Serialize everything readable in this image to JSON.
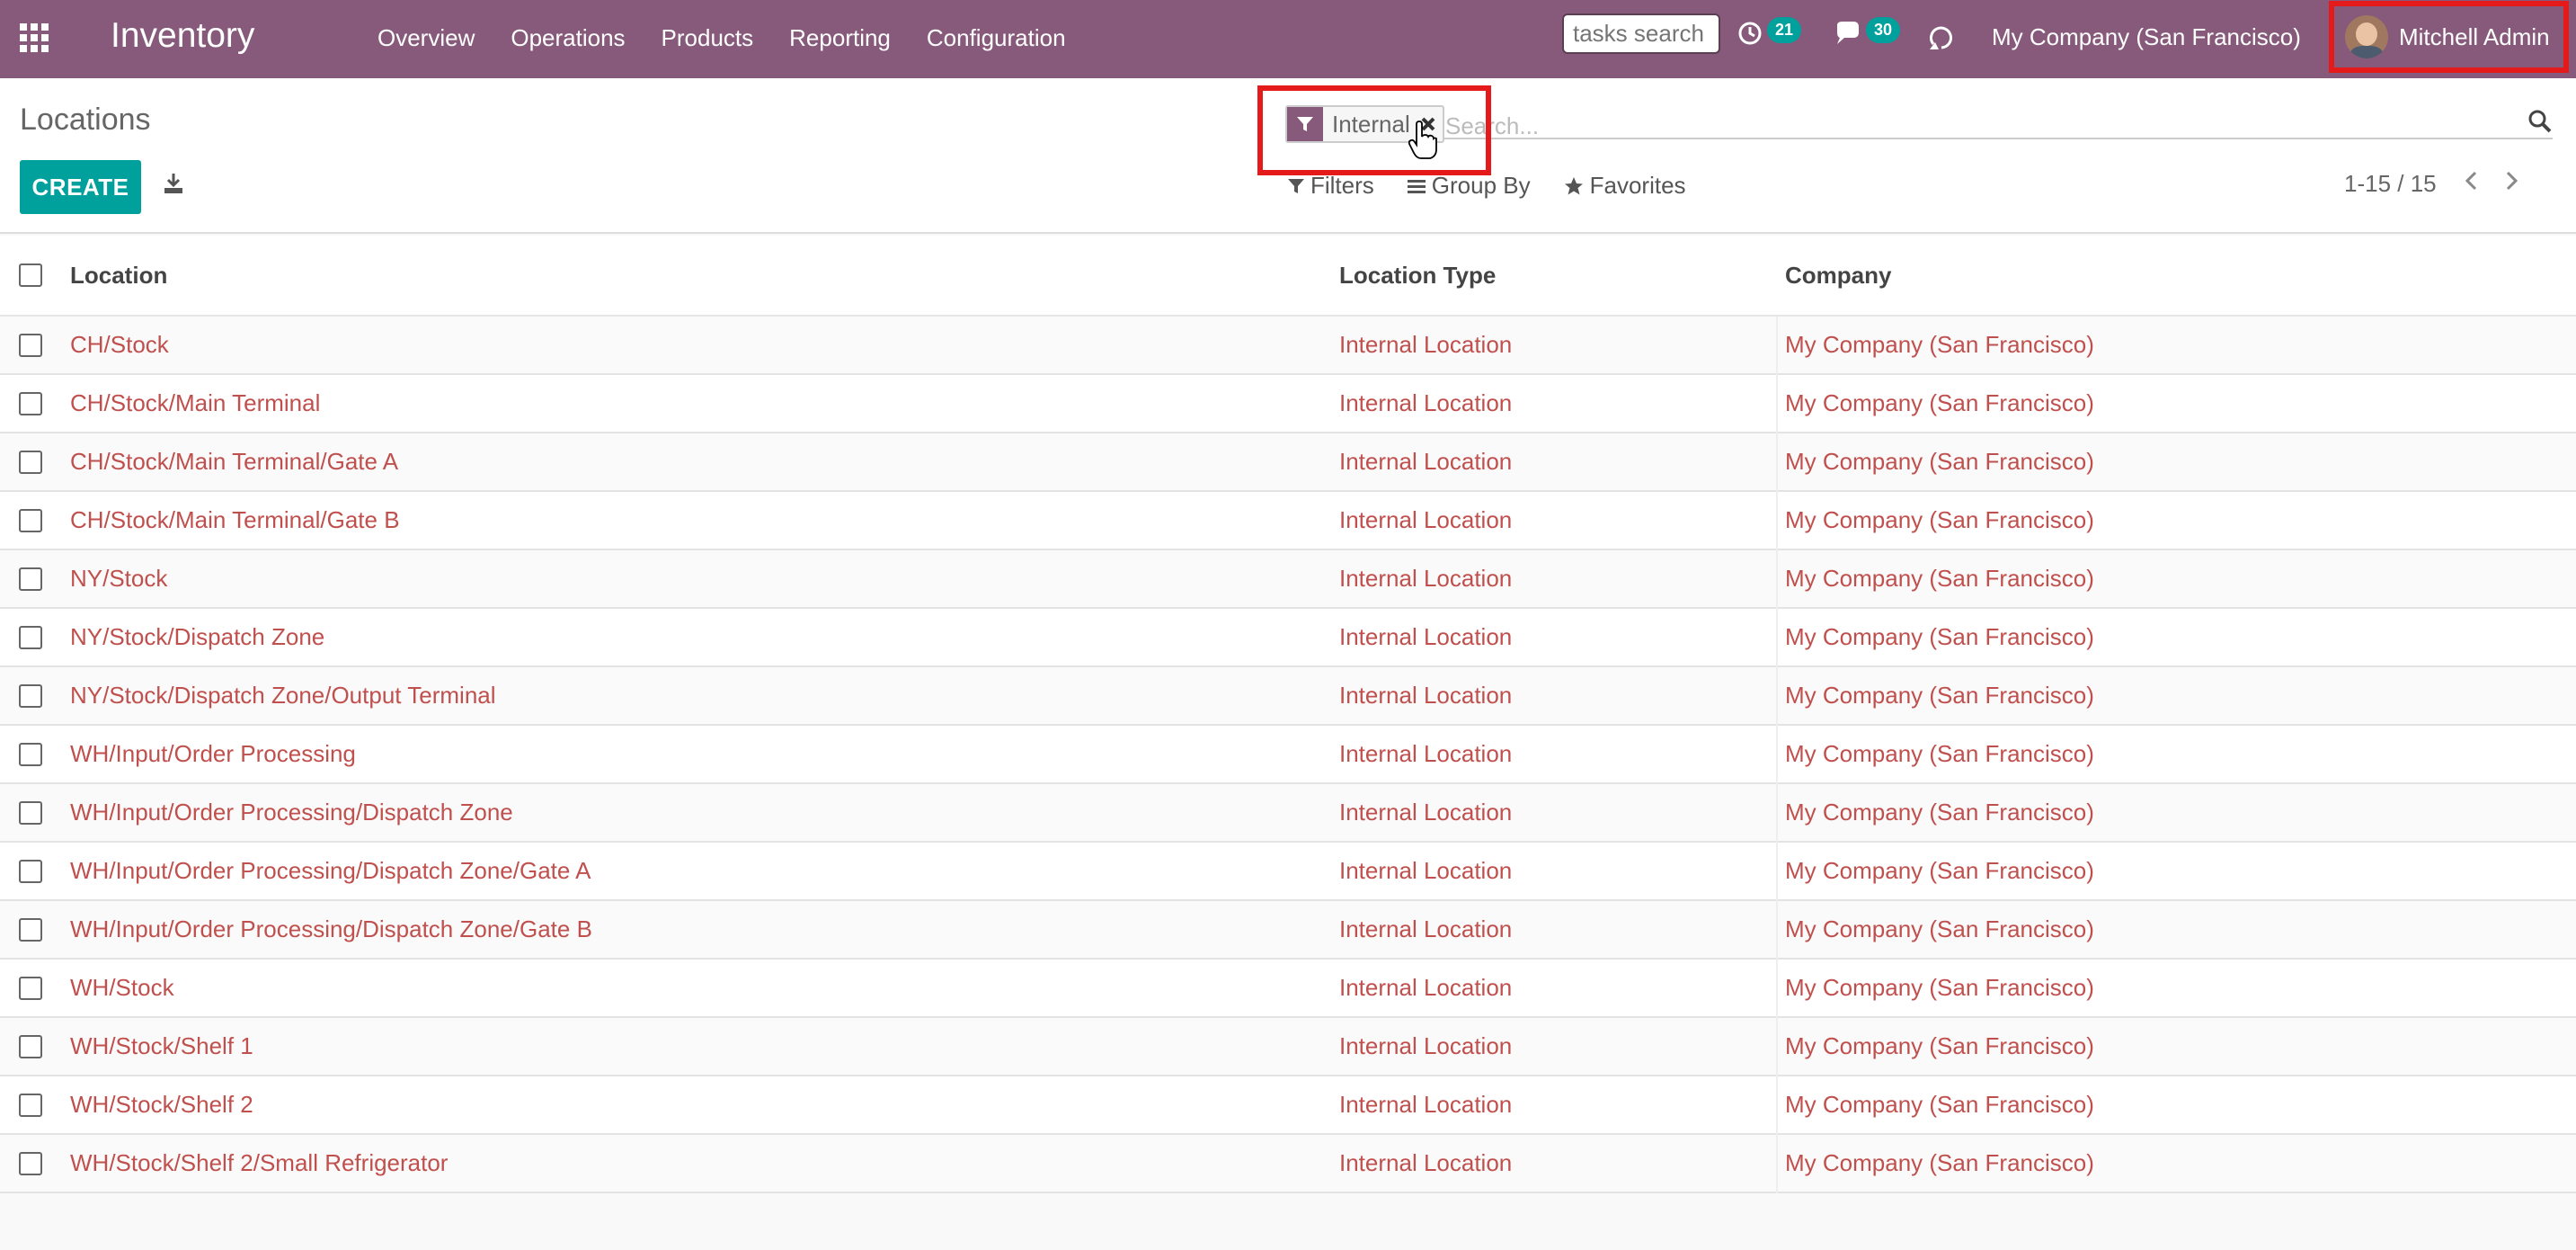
{
  "navbar": {
    "app_name": "Inventory",
    "menu": [
      "Overview",
      "Operations",
      "Products",
      "Reporting",
      "Configuration"
    ],
    "tasks_search_placeholder": "tasks search",
    "activity_count": "21",
    "messages_count": "30",
    "company": "My Company (San Francisco)",
    "user": "Mitchell Admin",
    "bg_color": "#875a7b"
  },
  "control": {
    "breadcrumb": "Locations",
    "create_label": "CREATE",
    "facet_label": "Internal",
    "search_placeholder": "Search...",
    "filters_label": "Filters",
    "groupby_label": "Group By",
    "favorites_label": "Favorites",
    "pager_value": "1-15 / 15"
  },
  "table": {
    "headers": {
      "location": "Location",
      "type": "Location Type",
      "company": "Company"
    },
    "rows": [
      {
        "location": "CH/Stock",
        "type": "Internal Location",
        "company": "My Company (San Francisco)"
      },
      {
        "location": "CH/Stock/Main Terminal",
        "type": "Internal Location",
        "company": "My Company (San Francisco)"
      },
      {
        "location": "CH/Stock/Main Terminal/Gate A",
        "type": "Internal Location",
        "company": "My Company (San Francisco)"
      },
      {
        "location": "CH/Stock/Main Terminal/Gate B",
        "type": "Internal Location",
        "company": "My Company (San Francisco)"
      },
      {
        "location": "NY/Stock",
        "type": "Internal Location",
        "company": "My Company (San Francisco)"
      },
      {
        "location": "NY/Stock/Dispatch Zone",
        "type": "Internal Location",
        "company": "My Company (San Francisco)"
      },
      {
        "location": "NY/Stock/Dispatch Zone/Output Terminal",
        "type": "Internal Location",
        "company": "My Company (San Francisco)"
      },
      {
        "location": "WH/Input/Order Processing",
        "type": "Internal Location",
        "company": "My Company (San Francisco)"
      },
      {
        "location": "WH/Input/Order Processing/Dispatch Zone",
        "type": "Internal Location",
        "company": "My Company (San Francisco)"
      },
      {
        "location": "WH/Input/Order Processing/Dispatch Zone/Gate A",
        "type": "Internal Location",
        "company": "My Company (San Francisco)"
      },
      {
        "location": "WH/Input/Order Processing/Dispatch Zone/Gate B",
        "type": "Internal Location",
        "company": "My Company (San Francisco)"
      },
      {
        "location": "WH/Stock",
        "type": "Internal Location",
        "company": "My Company (San Francisco)"
      },
      {
        "location": "WH/Stock/Shelf 1",
        "type": "Internal Location",
        "company": "My Company (San Francisco)"
      },
      {
        "location": "WH/Stock/Shelf 2",
        "type": "Internal Location",
        "company": "My Company (San Francisco)"
      },
      {
        "location": "WH/Stock/Shelf 2/Small Refrigerator",
        "type": "Internal Location",
        "company": "My Company (San Francisco)"
      }
    ]
  },
  "colors": {
    "accent": "#00a09d",
    "link": "#c0504d",
    "highlight": "#e51b1b"
  }
}
